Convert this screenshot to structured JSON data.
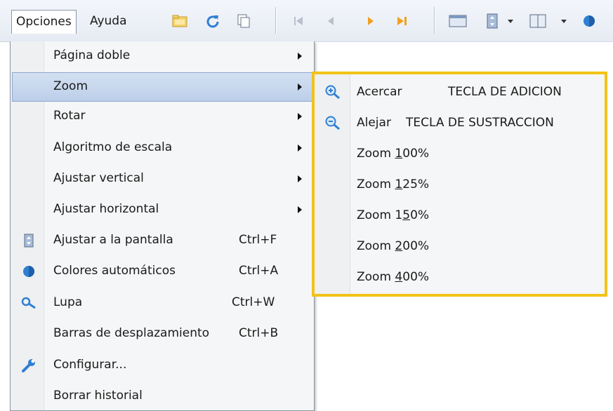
{
  "menubar": {
    "menus": [
      {
        "label": "Opciones"
      },
      {
        "label": "Ayuda"
      }
    ],
    "toolbar_icons": [
      "folder-icon",
      "refresh-icon",
      "copy-icon",
      "first-page-icon",
      "previous-page-icon",
      "next-page-icon",
      "last-page-icon",
      "single-page-icon",
      "fit-page-icon",
      "double-page-icon",
      "color-icon"
    ]
  },
  "options_menu": {
    "items": [
      {
        "label": "Página doble",
        "submenu": true
      },
      {
        "label": "Zoom",
        "submenu": true
      },
      {
        "label": "Rotar",
        "submenu": true
      },
      {
        "label": "Algoritmo de escala",
        "submenu": true
      },
      {
        "label": "Ajustar vertical",
        "submenu": true
      },
      {
        "label": "Ajustar horizontal",
        "submenu": true
      },
      {
        "label": "Ajustar a la pantalla",
        "shortcut": "Ctrl+F",
        "icon": "fit-screen-icon"
      },
      {
        "label": "Colores automáticos",
        "shortcut": "Ctrl+A",
        "icon": "color-icon"
      },
      {
        "label": "Lupa",
        "shortcut": "Ctrl+W",
        "icon": "magnifier-icon"
      },
      {
        "label": "Barras de desplazamiento",
        "shortcut": "Ctrl+B"
      },
      {
        "label": "Configurar...",
        "icon": "wrench-icon"
      },
      {
        "label": "Borrar historial"
      }
    ]
  },
  "zoom_submenu": {
    "items": [
      {
        "label": "Acercar",
        "shortcut": "TECLA DE ADICION",
        "icon": "zoom-in-icon"
      },
      {
        "label": "Alejar",
        "shortcut": "TECLA DE SUSTRACCION",
        "icon": "zoom-out-icon"
      },
      {
        "label_pre": "Zoom ",
        "mnemonic": "1",
        "label_post": "00%"
      },
      {
        "label_pre": "Zoom ",
        "mnemonic": "1",
        "label_post": "25%"
      },
      {
        "label_pre": "Zoom 1",
        "mnemonic": "5",
        "label_post": "0%"
      },
      {
        "label_pre": "Zoom ",
        "mnemonic": "2",
        "label_post": "00%"
      },
      {
        "label_pre": "Zoom ",
        "mnemonic": "4",
        "label_post": "00%"
      }
    ]
  },
  "colors": {
    "highlight_border": "#f2c318",
    "hover_fill": "#c6d7ee",
    "blue_icon": "#2f7fd3",
    "orange_icon": "#f0a020"
  }
}
